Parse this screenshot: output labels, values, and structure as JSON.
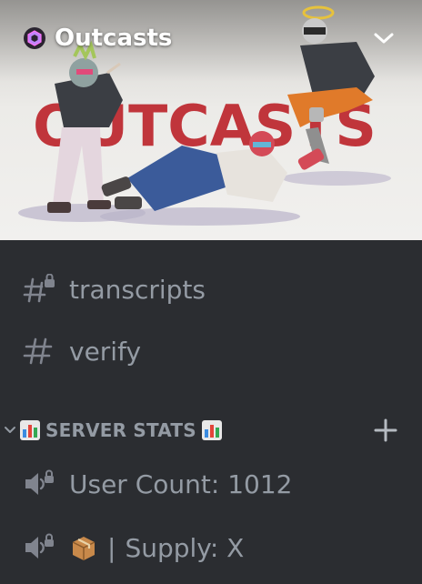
{
  "server": {
    "name": "Outcasts",
    "banner_text": "OUTCASTS"
  },
  "channels": [
    {
      "name": "transcripts",
      "icon": "locked-hashtag-icon"
    },
    {
      "name": "verify",
      "icon": "hashtag-icon"
    }
  ],
  "category": {
    "label": "SERVER STATS",
    "icon": "bar-chart-emoji"
  },
  "voice_channels": [
    {
      "name": "User Count: 1012",
      "icon": "locked-speaker-icon"
    },
    {
      "prefix": "|",
      "name": "Supply: X",
      "icon": "locked-speaker-icon",
      "emoji": "package-emoji"
    }
  ],
  "colors": {
    "sidebar_bg": "#2b2d31",
    "channel_text": "#949ba4",
    "banner_red": "#c0353b",
    "header_text": "#ffffff"
  }
}
